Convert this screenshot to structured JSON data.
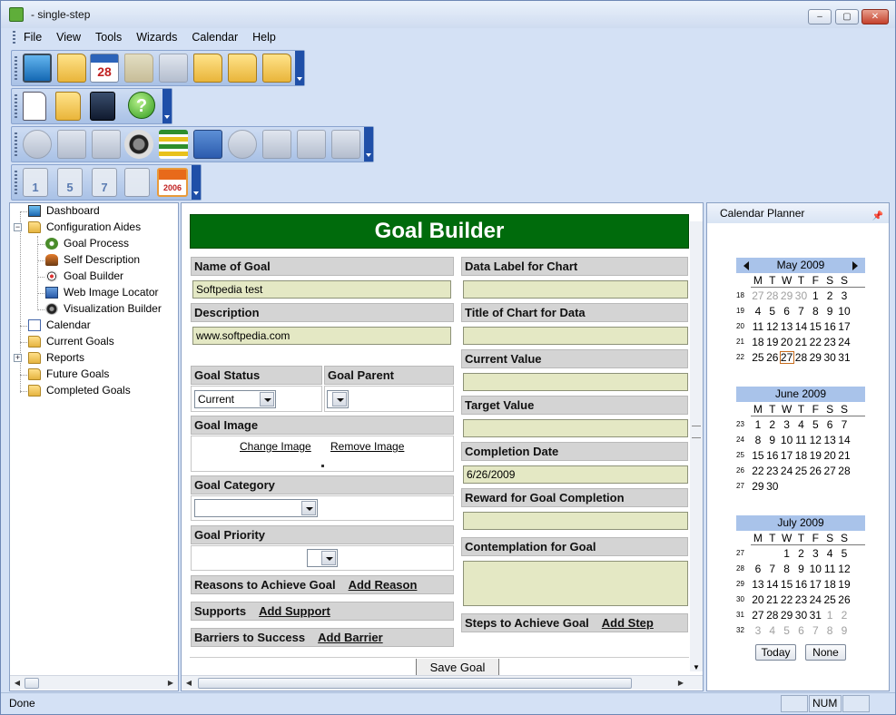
{
  "window": {
    "title": "- single-step",
    "controls": {
      "minimize": "–",
      "maximize": "▢",
      "close": "✕"
    }
  },
  "menu": [
    "File",
    "View",
    "Tools",
    "Wizards",
    "Calendar",
    "Help"
  ],
  "toolbar_icons": {
    "row1": [
      "dashboard-icon",
      "folder-gear-icon",
      "calendar-28-icon",
      "folder-disabled-icon",
      "window-disabled-icon",
      "open-folder-icon",
      "folder-arrow-icon",
      "folder-star-icon"
    ],
    "row2": [
      "new-document-icon",
      "copy-folder-icon",
      "save-disk-icon",
      "help-icon"
    ],
    "row3": [
      "gear-disabled-icon",
      "gear-doc-disabled-icon",
      "gear-chart-disabled-icon",
      "film-reel-icon",
      "list-icon",
      "window-gear-icon",
      "target-disabled-icon",
      "chart-disabled-icon",
      "tools-disabled-icon",
      "people-disabled-icon"
    ],
    "row4": [
      "calendar-1-icon",
      "calendar-5-icon",
      "calendar-7-icon",
      "calendar-month-icon",
      "calendar-year-icon"
    ]
  },
  "calendar_icon_labels": {
    "day28": "28",
    "c1": "1",
    "c5": "5",
    "c7": "7",
    "year": "2006"
  },
  "tree": [
    {
      "label": "Dashboard",
      "icon": "dashboard-icon"
    },
    {
      "label": "Configuration Aides",
      "icon": "folder-icon"
    },
    {
      "label": "Goal Process",
      "icon": "gear-icon"
    },
    {
      "label": "Self Description",
      "icon": "person-icon"
    },
    {
      "label": "Goal Builder",
      "icon": "target-icon"
    },
    {
      "label": "Web Image Locator",
      "icon": "web-icon"
    },
    {
      "label": "Visualization Builder",
      "icon": "film-icon"
    },
    {
      "label": "Calendar",
      "icon": "calendar-icon"
    },
    {
      "label": "Current Goals",
      "icon": "folder-icon"
    },
    {
      "label": "Reports",
      "icon": "folder-icon"
    },
    {
      "label": "Future Goals",
      "icon": "folder-icon"
    },
    {
      "label": "Completed Goals",
      "icon": "folder-icon"
    }
  ],
  "goal_builder": {
    "title": "Goal Builder",
    "name_label": "Name of Goal",
    "name_value": "Softpedia test",
    "description_label": "Description",
    "description_value": "www.softpedia.com",
    "status_label": "Goal Status",
    "status_value": "Current",
    "parent_label": "Goal Parent",
    "parent_value": "",
    "image_label": "Goal Image",
    "change_image": "Change Image",
    "remove_image": "Remove Image",
    "category_label": "Goal Category",
    "category_value": "",
    "priority_label": "Goal Priority",
    "priority_value": "",
    "reasons_label": "Reasons to Achieve Goal",
    "add_reason": "Add Reason",
    "supports_label": "Supports",
    "add_support": "Add Support",
    "barriers_label": "Barriers to Success",
    "add_barrier": "Add Barrier",
    "data_label_label": "Data Label for Chart",
    "data_label_value": "",
    "chart_title_label": "Title of Chart for Data",
    "chart_title_value": "",
    "current_value_label": "Current Value",
    "current_value": "",
    "target_value_label": "Target Value",
    "target_value": "",
    "completion_date_label": "Completion Date",
    "completion_date_value": "6/26/2009",
    "reward_label": "Reward for Goal Completion",
    "reward_value": "",
    "contemplation_label": "Contemplation for Goal",
    "contemplation_value": "",
    "steps_label": "Steps to Achieve Goal",
    "add_step": "Add Step",
    "save_button": "Save Goal"
  },
  "calendar_planner": {
    "title": "Calendar Planner",
    "pin": "📌",
    "day_headers": [
      "M",
      "T",
      "W",
      "T",
      "F",
      "S",
      "S"
    ],
    "months": [
      {
        "name": "May 2009",
        "nav": true,
        "weeks": [
          {
            "wn": "18",
            "days": [
              "27",
              "28",
              "29",
              "30",
              "1",
              "2",
              "3"
            ],
            "other": [
              0,
              1,
              2,
              3
            ]
          },
          {
            "wn": "19",
            "days": [
              "4",
              "5",
              "6",
              "7",
              "8",
              "9",
              "10"
            ],
            "other": []
          },
          {
            "wn": "20",
            "days": [
              "11",
              "12",
              "13",
              "14",
              "15",
              "16",
              "17"
            ],
            "other": []
          },
          {
            "wn": "21",
            "days": [
              "18",
              "19",
              "20",
              "21",
              "22",
              "23",
              "24"
            ],
            "other": []
          },
          {
            "wn": "22",
            "days": [
              "25",
              "26",
              "27",
              "28",
              "29",
              "30",
              "31"
            ],
            "other": [],
            "today": 2
          }
        ]
      },
      {
        "name": "June 2009",
        "nav": false,
        "weeks": [
          {
            "wn": "23",
            "days": [
              "1",
              "2",
              "3",
              "4",
              "5",
              "6",
              "7"
            ],
            "other": []
          },
          {
            "wn": "24",
            "days": [
              "8",
              "9",
              "10",
              "11",
              "12",
              "13",
              "14"
            ],
            "other": []
          },
          {
            "wn": "25",
            "days": [
              "15",
              "16",
              "17",
              "18",
              "19",
              "20",
              "21"
            ],
            "other": []
          },
          {
            "wn": "26",
            "days": [
              "22",
              "23",
              "24",
              "25",
              "26",
              "27",
              "28"
            ],
            "other": []
          },
          {
            "wn": "27",
            "days": [
              "29",
              "30",
              "",
              "",
              "",
              "",
              ""
            ],
            "other": []
          }
        ]
      },
      {
        "name": "July 2009",
        "nav": false,
        "weeks": [
          {
            "wn": "27",
            "days": [
              "",
              "",
              "1",
              "2",
              "3",
              "4",
              "5"
            ],
            "other": []
          },
          {
            "wn": "28",
            "days": [
              "6",
              "7",
              "8",
              "9",
              "10",
              "11",
              "12"
            ],
            "other": []
          },
          {
            "wn": "29",
            "days": [
              "13",
              "14",
              "15",
              "16",
              "17",
              "18",
              "19"
            ],
            "other": []
          },
          {
            "wn": "30",
            "days": [
              "20",
              "21",
              "22",
              "23",
              "24",
              "25",
              "26"
            ],
            "other": []
          },
          {
            "wn": "31",
            "days": [
              "27",
              "28",
              "29",
              "30",
              "31",
              "1",
              "2"
            ],
            "other": [
              5,
              6
            ]
          },
          {
            "wn": "32",
            "days": [
              "3",
              "4",
              "5",
              "6",
              "7",
              "8",
              "9"
            ],
            "other": [
              0,
              1,
              2,
              3,
              4,
              5,
              6
            ]
          }
        ]
      }
    ],
    "today_button": "Today",
    "none_button": "None"
  },
  "status_bar": {
    "text": "Done",
    "num": "NUM"
  }
}
